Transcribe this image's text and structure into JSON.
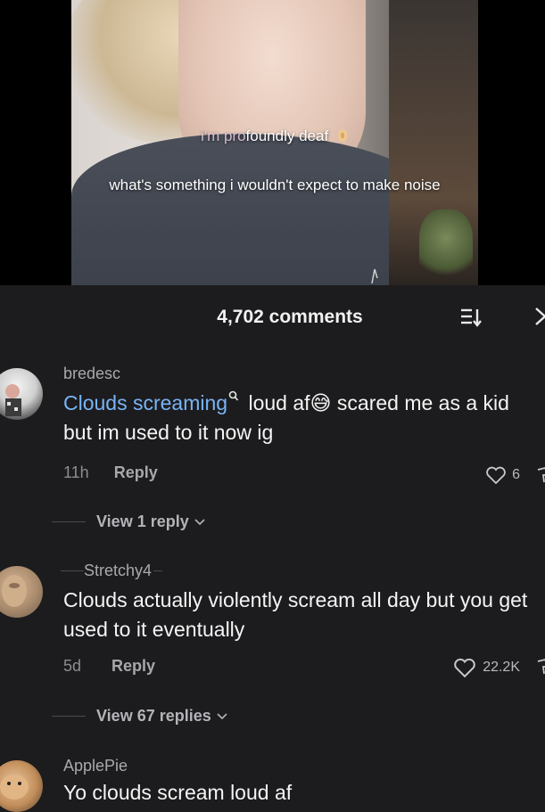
{
  "video": {
    "caption_faded": "i'm pro",
    "caption_rest": "foundly deaf",
    "caption_question": "what's something i wouldn't expect to make noise"
  },
  "header": {
    "comments_count": "4,702 comments",
    "sort_icon": "sort-icon",
    "close_icon": "close-icon"
  },
  "comments": [
    {
      "username": "bredesc",
      "text_keyword": "Clouds screaming",
      "text_rest": " loud af",
      "text_after_emoji": " scared me as a kid but im used to it now ig",
      "emoji": "😅",
      "time": "11h",
      "reply_label": "Reply",
      "likes": "6",
      "view_replies": "View 1 reply"
    },
    {
      "username": "Stretchy4",
      "text": "Clouds actually violently scream all day but you get used to it eventually",
      "time": "5d",
      "reply_label": "Reply",
      "likes": "22.2K",
      "view_replies": "View 67 replies"
    },
    {
      "username": "ApplePie",
      "text": "Yo clouds scream loud af"
    }
  ],
  "colors": {
    "background": "#1c1c1e",
    "keyword_link": "#79b4f5",
    "muted": "#8d8d92"
  }
}
